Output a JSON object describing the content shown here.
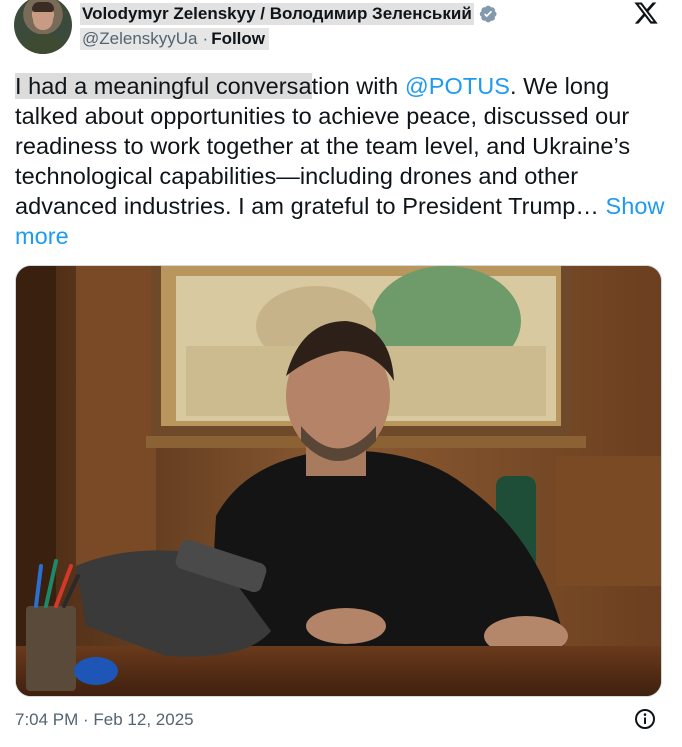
{
  "author": {
    "display_name": "Volodymyr Zelenskyy / Володимир Зеленський",
    "handle": "@ZelenskyyUa",
    "separator": "·",
    "follow_label": "Follow",
    "verified": true
  },
  "tweet": {
    "text_selected": "I had a meaningful conversa",
    "text_before_mention": "tion with ",
    "mention": "@POTUS",
    "text_after_mention": ". We long talked about  opportunities to achieve peace, discussed our readiness to work together at the team level, and Ukraine’s technological capabilities—including drones and other advanced industries. I am grateful to President Trump… ",
    "show_more_label": "Show more"
  },
  "meta": {
    "timestamp": "7:04 PM · Feb 12, 2025"
  },
  "icons": {
    "x_logo": "x-logo-icon",
    "verified": "verified-badge-icon",
    "info": "info-icon"
  },
  "colors": {
    "link": "#1d9bf0",
    "text": "#0f1419",
    "secondary": "#536471"
  }
}
